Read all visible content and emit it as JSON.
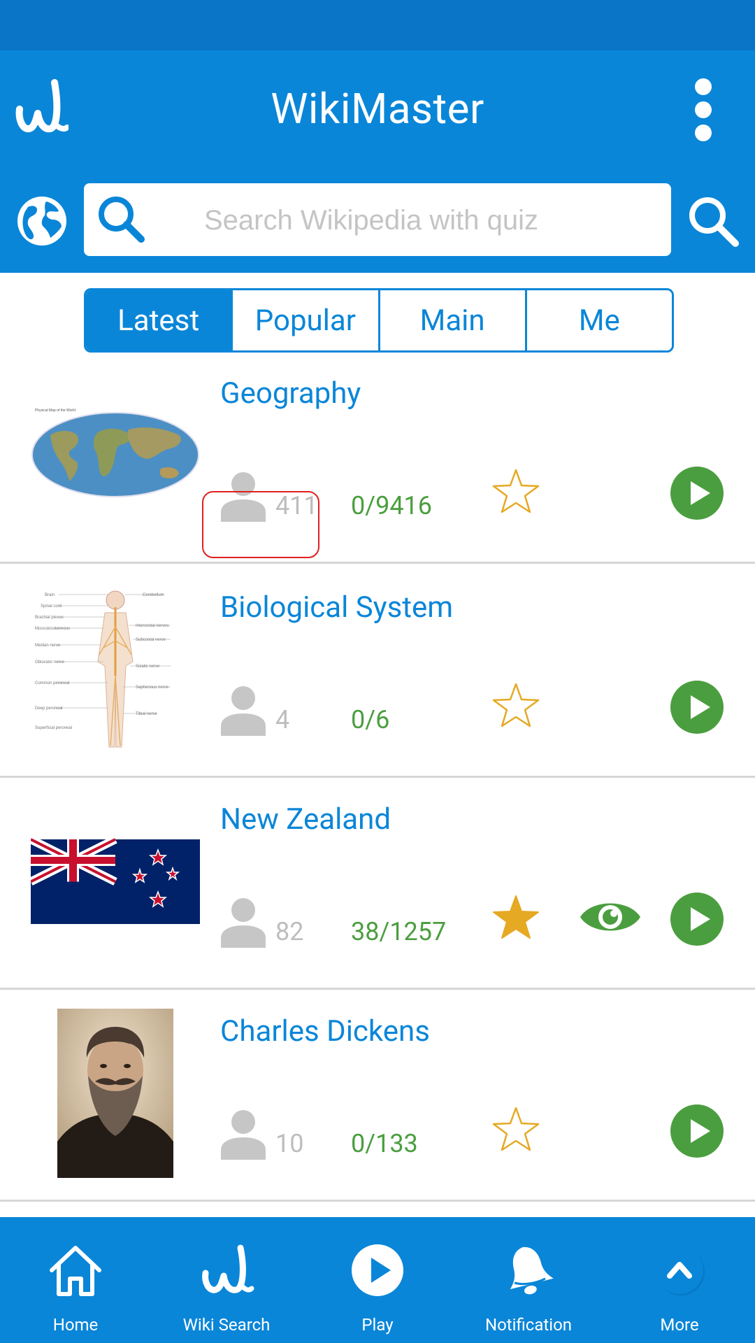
{
  "app": {
    "title": "WikiMaster"
  },
  "search": {
    "placeholder": "Search Wikipedia with quiz",
    "value": ""
  },
  "tabs": [
    {
      "label": "Latest",
      "selected": true
    },
    {
      "label": "Popular",
      "selected": false
    },
    {
      "label": "Main",
      "selected": false
    },
    {
      "label": "Me",
      "selected": false
    }
  ],
  "quizzes": [
    {
      "title": "Geography",
      "thumbnail": "world-map-image",
      "users": "411",
      "progress": "0/9416",
      "favorite": false,
      "watched": false
    },
    {
      "title": "Biological System",
      "thumbnail": "nervous-system-diagram",
      "users": "4",
      "progress": "0/6",
      "favorite": false,
      "watched": false
    },
    {
      "title": "New Zealand",
      "thumbnail": "new-zealand-flag",
      "users": "82",
      "progress": "38/1257",
      "favorite": true,
      "watched": true
    },
    {
      "title": "Charles Dickens",
      "thumbnail": "charles-dickens-portrait",
      "users": "10",
      "progress": "0/133",
      "favorite": false,
      "watched": false
    }
  ],
  "bottom_nav": [
    {
      "label": "Home",
      "icon": "home-icon"
    },
    {
      "label": "Wiki Search",
      "icon": "wiki-logo-icon"
    },
    {
      "label": "Play",
      "icon": "play-icon"
    },
    {
      "label": "Notification",
      "icon": "bell-icon"
    },
    {
      "label": "More",
      "icon": "chevron-up-icon"
    }
  ],
  "colors": {
    "primary": "#0A86D8",
    "status_bar": "#0A75C7",
    "green": "#4b9e3f",
    "star": "#E5A923"
  }
}
